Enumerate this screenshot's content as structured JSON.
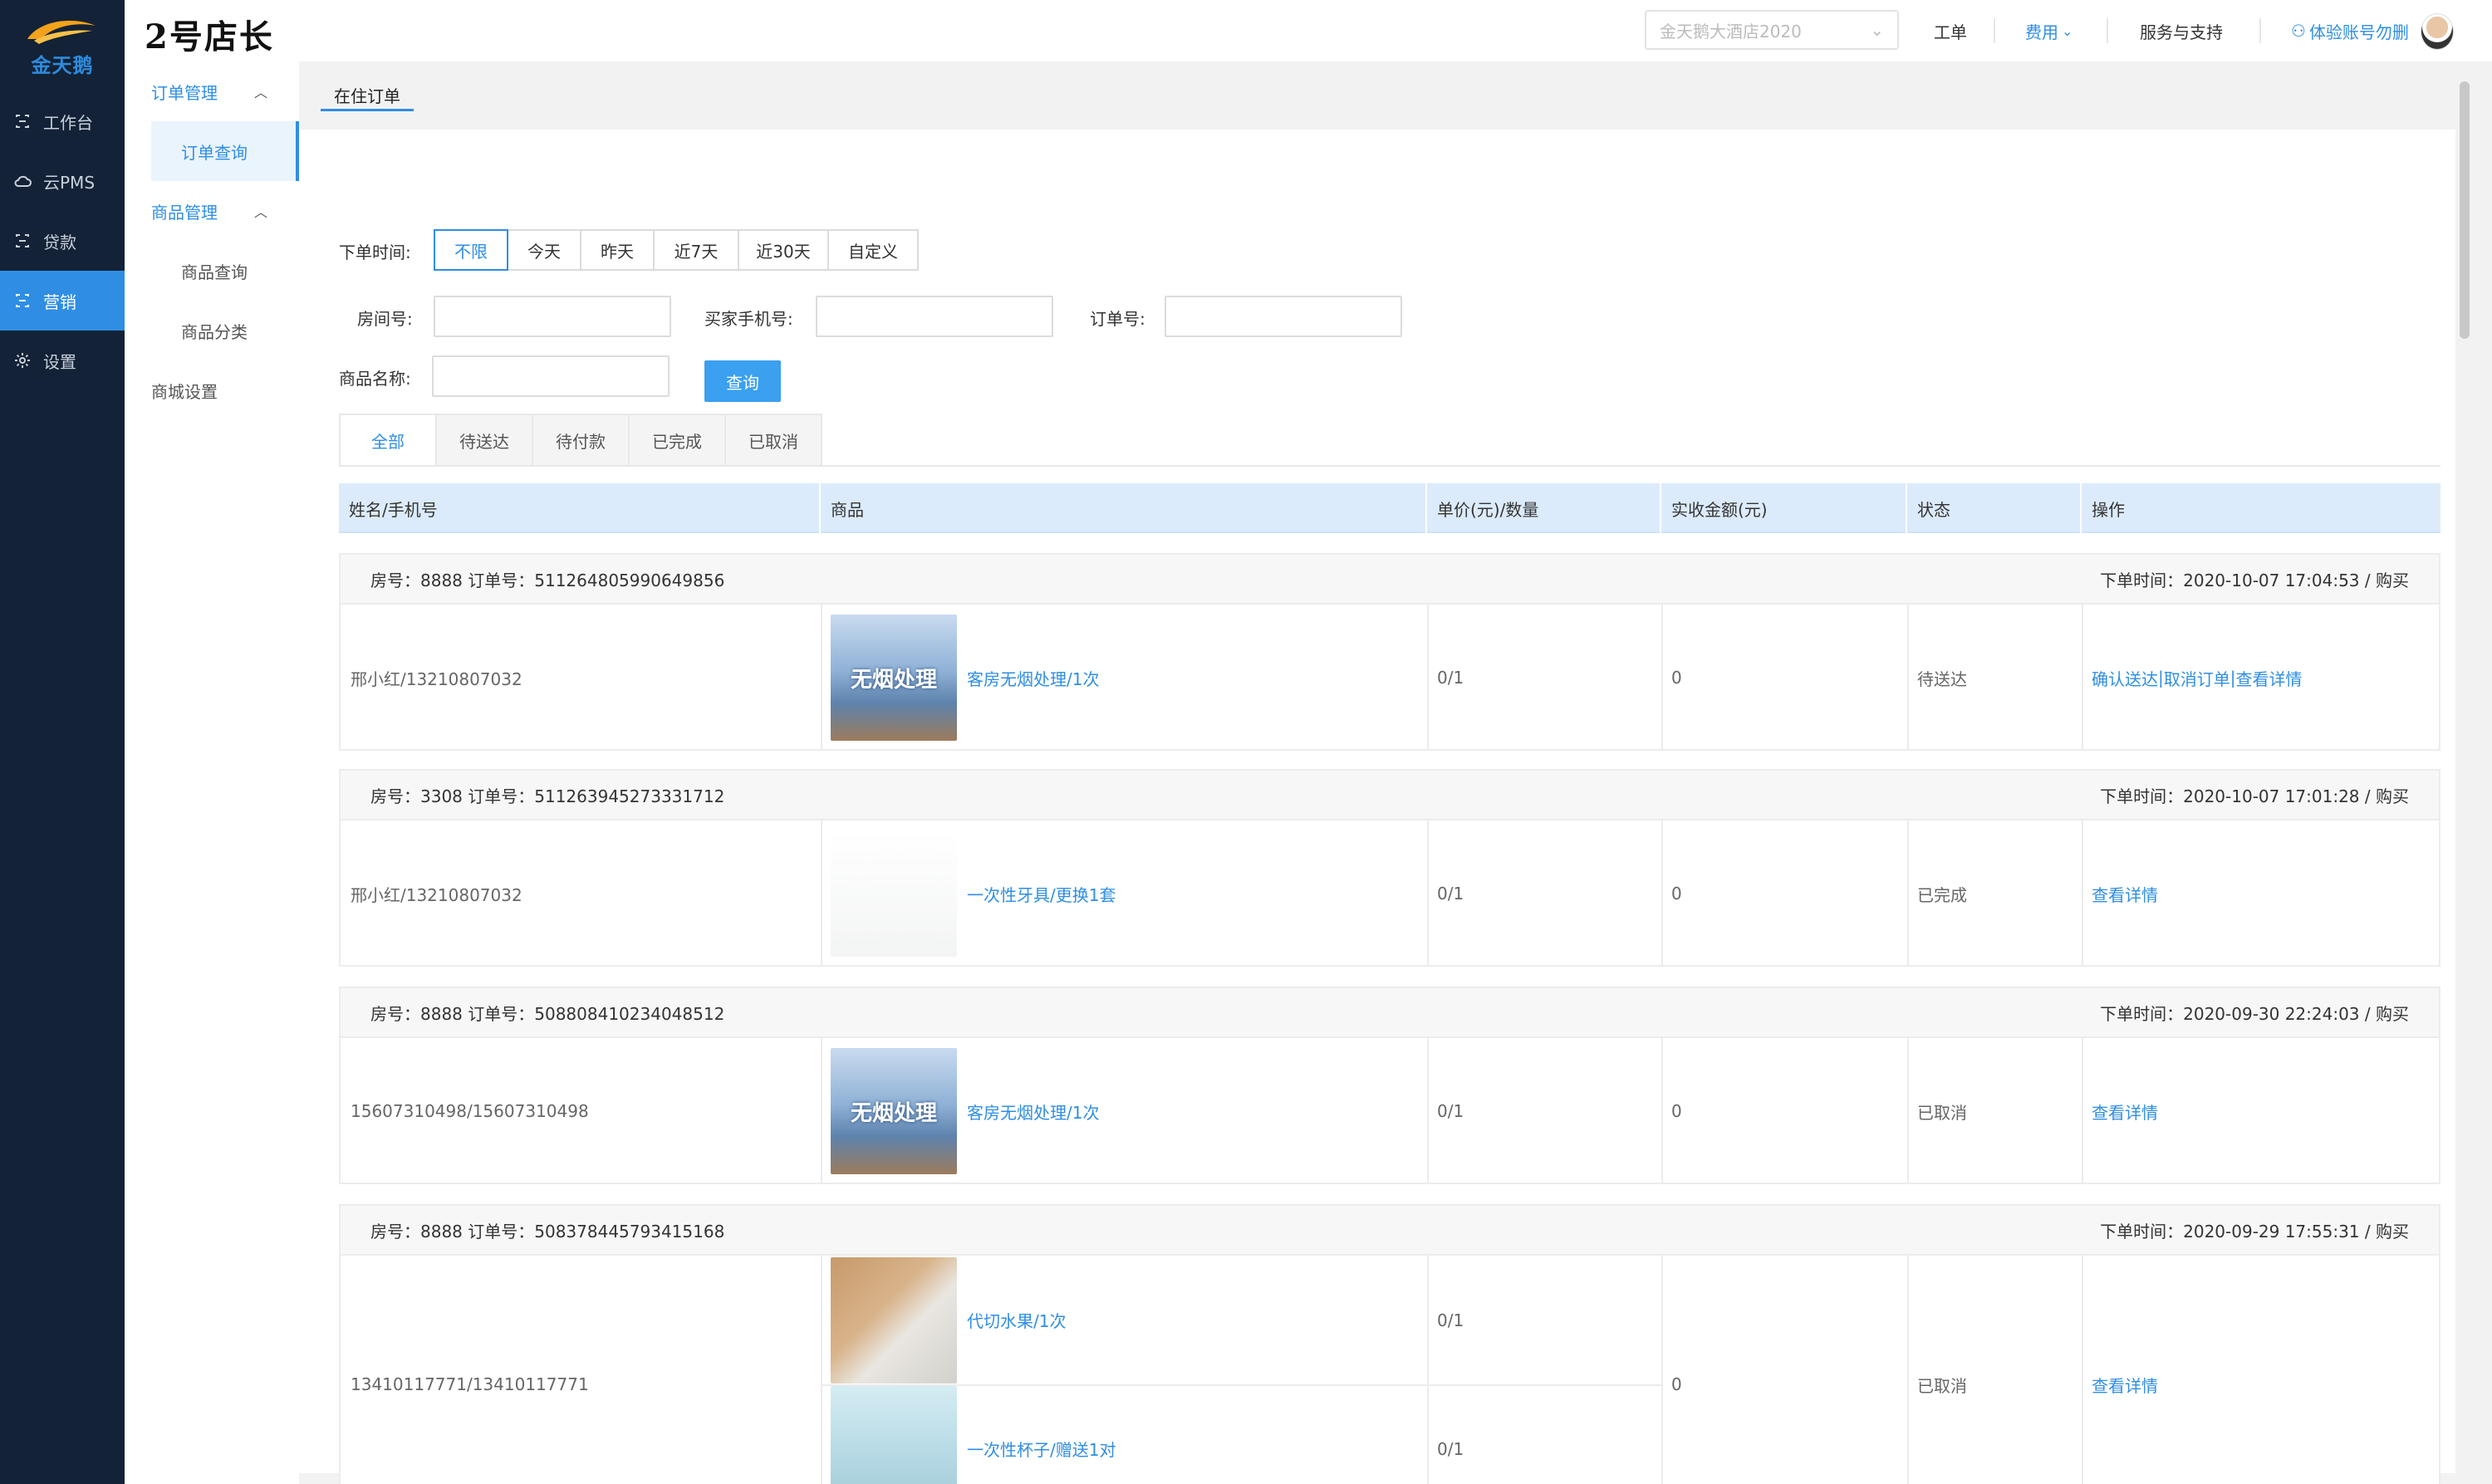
{
  "logo": {
    "text": "金天鹅"
  },
  "brand": "2号店长",
  "nav": [
    {
      "label": "工作台",
      "icon": "bracket-icon"
    },
    {
      "label": "云PMS",
      "icon": "cloud-icon"
    },
    {
      "label": "贷款",
      "icon": "bracket-icon"
    },
    {
      "label": "营销",
      "icon": "bracket-icon",
      "active": true
    },
    {
      "label": "设置",
      "icon": "gear-icon"
    }
  ],
  "subnav": {
    "order_mgmt": "订单管理",
    "order_query": "订单查询",
    "goods_mgmt": "商品管理",
    "goods_query": "商品查询",
    "goods_category": "商品分类",
    "mall_settings": "商城设置"
  },
  "topbar": {
    "hotel_select": "金天鹅大酒店2020",
    "work_order": "工单",
    "fees": "费用",
    "service": "服务与支持",
    "account": "体验账号勿删"
  },
  "page_tab": "在住订单",
  "filters": {
    "order_time_label": "下单时间:",
    "time_options": [
      "不限",
      "今天",
      "昨天",
      "近7天",
      "近30天",
      "自定义"
    ],
    "room_label": "房间号:",
    "buyer_phone_label": "买家手机号:",
    "order_no_label": "订单号:",
    "goods_name_label": "商品名称:",
    "query_button": "查询"
  },
  "status_tabs": [
    "全部",
    "待送达",
    "待付款",
    "已完成",
    "已取消"
  ],
  "table": {
    "headers": [
      "姓名/手机号",
      "商品",
      "单价(元)/数量",
      "实收金额(元)",
      "状态",
      "操作"
    ]
  },
  "orders": [
    {
      "head_left": "房号：8888  订单号：511264805990649856",
      "head_right": "下单时间：2020-10-07 17:04:53 / 购买",
      "customer": "邢小红/13210807032",
      "items": [
        {
          "name": "客房无烟处理/1次",
          "thumb": "smoke",
          "thumb_text": "无烟处理",
          "price_qty": "0/1"
        }
      ],
      "amount": "0",
      "status": "待送达",
      "actions": [
        "确认送达",
        "取消订单",
        "查看详情"
      ]
    },
    {
      "head_left": "房号：3308  订单号：511263945273331712",
      "head_right": "下单时间：2020-10-07 17:01:28 / 购买",
      "customer": "邢小红/13210807032",
      "items": [
        {
          "name": "一次性牙具/更换1套",
          "thumb": "tooth",
          "thumb_text": "",
          "price_qty": "0/1"
        }
      ],
      "amount": "0",
      "status": "已完成",
      "actions": [
        "查看详情"
      ]
    },
    {
      "head_left": "房号：8888  订单号：508808410234048512",
      "head_right": "下单时间：2020-09-30 22:24:03 / 购买",
      "customer": "15607310498/15607310498",
      "items": [
        {
          "name": "客房无烟处理/1次",
          "thumb": "smoke",
          "thumb_text": "无烟处理",
          "price_qty": "0/1"
        }
      ],
      "amount": "0",
      "status": "已取消",
      "actions": [
        "查看详情"
      ]
    },
    {
      "head_left": "房号：8888  订单号：508378445793415168",
      "head_right": "下单时间：2020-09-29 17:55:31 / 购买",
      "customer": "13410117771/13410117771",
      "items": [
        {
          "name": "代切水果/1次",
          "thumb": "fruit",
          "thumb_text": "",
          "price_qty": "0/1"
        },
        {
          "name": "一次性杯子/赠送1对",
          "thumb": "cup",
          "thumb_text": "",
          "price_qty": "0/1"
        }
      ],
      "amount": "0",
      "status": "已取消",
      "actions": [
        "查看详情"
      ]
    }
  ]
}
